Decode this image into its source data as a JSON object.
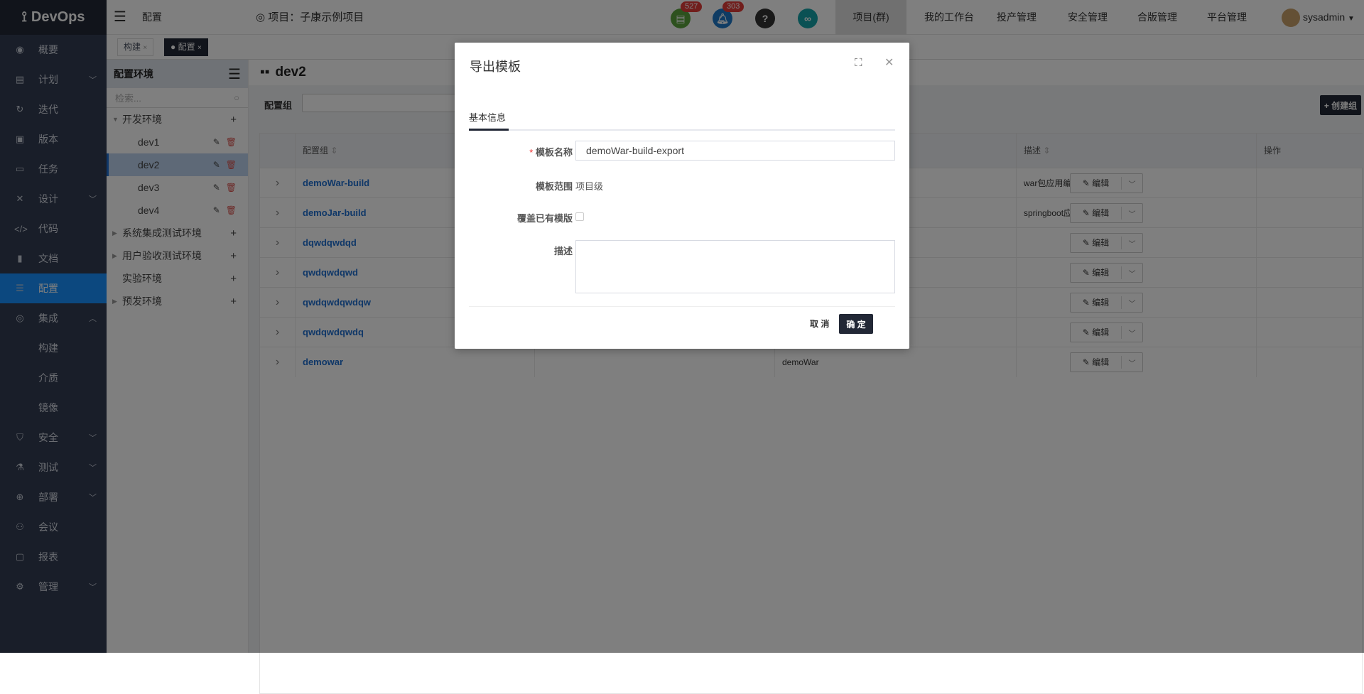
{
  "app": {
    "logo": "DevOps"
  },
  "sidebar": {
    "items": [
      {
        "label": "概要",
        "icon": "dashboard-icon",
        "glyph": "◉"
      },
      {
        "label": "计划",
        "icon": "plan-icon",
        "glyph": "▤",
        "chevron": "down"
      },
      {
        "label": "迭代",
        "icon": "iteration-icon",
        "glyph": "↻"
      },
      {
        "label": "版本",
        "icon": "version-icon",
        "glyph": "▣"
      },
      {
        "label": "任务",
        "icon": "task-icon",
        "glyph": "▭"
      },
      {
        "label": "设计",
        "icon": "design-icon",
        "glyph": "✕",
        "chevron": "down"
      },
      {
        "label": "代码",
        "icon": "code-icon",
        "glyph": "</>"
      },
      {
        "label": "文档",
        "icon": "document-icon",
        "glyph": "▮"
      },
      {
        "label": "配置",
        "icon": "database-icon",
        "glyph": "☰",
        "active": true
      },
      {
        "label": "集成",
        "icon": "integration-icon",
        "glyph": "◎",
        "chevron": "up"
      },
      {
        "label": "构建",
        "sub": true
      },
      {
        "label": "介质",
        "sub": true
      },
      {
        "label": "镜像",
        "sub": true
      },
      {
        "label": "安全",
        "icon": "shield-icon",
        "glyph": "⛉",
        "chevron": "down"
      },
      {
        "label": "测试",
        "icon": "flask-icon",
        "glyph": "⚗",
        "chevron": "down"
      },
      {
        "label": "部署",
        "icon": "crosshair-icon",
        "glyph": "⊕",
        "chevron": "down"
      },
      {
        "label": "会议",
        "icon": "meeting-icon",
        "glyph": "⚇"
      },
      {
        "label": "报表",
        "icon": "report-icon",
        "glyph": "▢"
      },
      {
        "label": "管理",
        "icon": "gear-icon",
        "glyph": "⚙",
        "chevron": "down"
      }
    ]
  },
  "header": {
    "breadcrumb": "配置",
    "project": "项目：子康示例项目",
    "doc_badge": "527",
    "bell_badge": "303",
    "nav": [
      "项目(群)",
      "我的工作台",
      "投产管理",
      "安全管理",
      "合版管理",
      "平台管理"
    ],
    "user": "sysadmin"
  },
  "tabs": [
    {
      "label": "构建",
      "close": "×"
    },
    {
      "label": "配置",
      "close": "×",
      "active": true
    }
  ],
  "env": {
    "title": "配置环境",
    "search_placeholder": "检索...",
    "tree": [
      {
        "label": "开发环境",
        "level": 0,
        "toggle": "▼",
        "add": "+"
      },
      {
        "label": "dev1",
        "level": 1
      },
      {
        "label": "dev2",
        "level": 1,
        "selected": true
      },
      {
        "label": "dev3",
        "level": 1
      },
      {
        "label": "dev4",
        "level": 1
      },
      {
        "label": "系统集成测试环境",
        "level": 0,
        "toggle": "▶",
        "add": "+"
      },
      {
        "label": "用户验收测试环境",
        "level": 0,
        "toggle": "▶",
        "add": "+"
      },
      {
        "label": "实验环境",
        "level": 0,
        "toggle": "",
        "add": "+"
      },
      {
        "label": "预发环境",
        "level": 0,
        "toggle": "▶",
        "add": "+"
      }
    ]
  },
  "main": {
    "title": "dev2",
    "filter_label": "配置组",
    "create_button": "+ 创建组",
    "columns": [
      "配置组",
      "",
      "",
      "描述",
      "操作"
    ],
    "rows": [
      {
        "name": "demoWar-build",
        "col3": "",
        "desc": "war包应用编译配置"
      },
      {
        "name": "demoJar-build",
        "col3": "",
        "desc": "springboot应用编译配置"
      },
      {
        "name": "dqwdqwdqd",
        "col3": "",
        "desc": ""
      },
      {
        "name": "qwdqwdqwd",
        "col3": "",
        "desc": ""
      },
      {
        "name": "qwdqwdqwdqw",
        "col3": "",
        "desc": ""
      },
      {
        "name": "qwdqwdqwdq",
        "col3": "",
        "desc": ""
      },
      {
        "name": "demowar",
        "col3": "demoWar",
        "desc": ""
      }
    ],
    "edit_label": "编辑"
  },
  "dialog": {
    "title": "导出模板",
    "tab": "基本信息",
    "name_label": "模板名称",
    "required_mark": "*",
    "name_value": "demoWar-build-export",
    "scope_label": "模板范围",
    "scope_value": "项目级",
    "overwrite_label": "覆盖已有模版",
    "desc_label": "描述",
    "cancel": "取 消",
    "ok": "确 定"
  }
}
